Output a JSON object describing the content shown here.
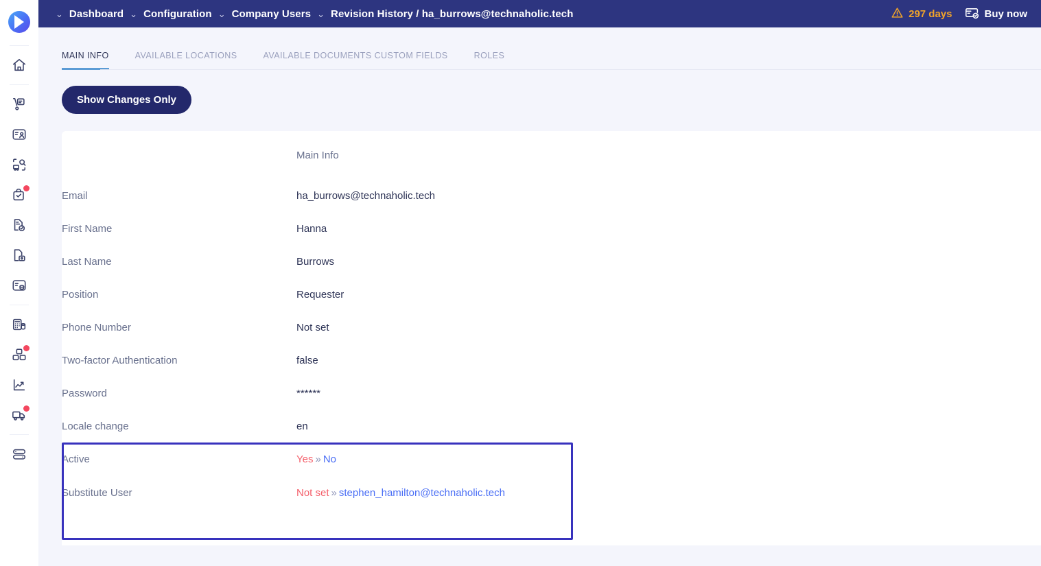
{
  "app": {
    "logo": "triangle-logo"
  },
  "header": {
    "breadcrumbs": [
      {
        "label": "Dashboard",
        "caret": "⌄"
      },
      {
        "label": "Configuration",
        "caret": "⌄"
      },
      {
        "label": "Company Users",
        "caret": "⌄"
      },
      {
        "label": "Revision History / ha_burrows@technaholic.tech",
        "caret": "⌄"
      }
    ],
    "trial": {
      "label": "297 days",
      "icon": "warning-triangle-icon",
      "color": "#f0a32a"
    },
    "buy": {
      "label": "Buy now",
      "icon": "card-check-icon"
    }
  },
  "sidebar": {
    "items": [
      {
        "name": "home",
        "icon": "home-icon",
        "badge": false
      },
      {
        "name": "purchasing",
        "icon": "hand-truck-icon",
        "badge": false
      },
      {
        "name": "suppliers",
        "icon": "contact-card-icon",
        "badge": false
      },
      {
        "name": "inventory-search",
        "icon": "truck-search-icon",
        "badge": false
      },
      {
        "name": "approvals",
        "icon": "bag-check-icon",
        "badge": true
      },
      {
        "name": "documents",
        "icon": "document-check-icon",
        "badge": false
      },
      {
        "name": "contracts",
        "icon": "document-lock-icon",
        "badge": false
      },
      {
        "name": "vendor-payments",
        "icon": "card-coin-icon",
        "badge": false
      },
      {
        "name": "invoices",
        "icon": "calculator-icon",
        "badge": false
      },
      {
        "name": "assets",
        "icon": "boxes-icon",
        "badge": true
      },
      {
        "name": "analytics",
        "icon": "trend-chart-icon",
        "badge": false
      },
      {
        "name": "deliveries",
        "icon": "delivery-truck-icon",
        "badge": true
      },
      {
        "name": "settings-server",
        "icon": "server-icon",
        "badge": false
      }
    ]
  },
  "tabs": [
    {
      "label": "MAIN INFO",
      "active": true
    },
    {
      "label": "AVAILABLE LOCATIONS",
      "active": false
    },
    {
      "label": "AVAILABLE DOCUMENTS CUSTOM FIELDS",
      "active": false
    },
    {
      "label": "ROLES",
      "active": false
    }
  ],
  "toolbar": {
    "show_changes_label": "Show Changes Only"
  },
  "table": {
    "column_header": "Main Info",
    "rows": [
      {
        "label": "Email",
        "value": "ha_burrows@technaholic.tech",
        "changed": false
      },
      {
        "label": "First Name",
        "value": "Hanna",
        "changed": false
      },
      {
        "label": "Last Name",
        "value": "Burrows",
        "changed": false
      },
      {
        "label": "Position",
        "value": "Requester",
        "changed": false
      },
      {
        "label": "Phone Number",
        "value": "Not set",
        "changed": false
      },
      {
        "label": "Two-factor Authentication",
        "value": "false",
        "changed": false
      },
      {
        "label": "Password",
        "value": "******",
        "changed": false
      },
      {
        "label": "Locale change",
        "value": "en",
        "changed": false
      }
    ],
    "changed_rows": [
      {
        "label": "Active",
        "old": "Yes",
        "arrow": "»",
        "new": "No"
      },
      {
        "label": "Substitute User",
        "old": "Not set",
        "arrow": "»",
        "new": "stephen_hamilton@technaholic.tech"
      }
    ]
  },
  "colors": {
    "header_bg": "#2d3580",
    "accent_button": "#23286b",
    "tab_active_underline": "#5b9bd5",
    "diff_box_border": "#3832bd",
    "old_value": "#f4606b",
    "new_value": "#4a6ef5",
    "badge": "#f4475f",
    "trial_warning": "#f0a32a",
    "page_bg": "#f4f5fc"
  }
}
